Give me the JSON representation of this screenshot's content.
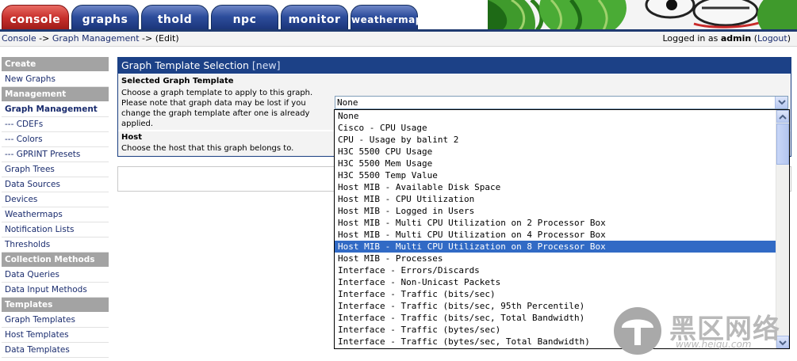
{
  "tabs": [
    {
      "label": "console",
      "active": true
    },
    {
      "label": "graphs",
      "active": false
    },
    {
      "label": "thold",
      "active": false
    },
    {
      "label": "npc",
      "active": false
    },
    {
      "label": "monitor",
      "active": false
    },
    {
      "label": "weathermap",
      "active": false
    }
  ],
  "breadcrumb": {
    "console": "Console",
    "sep1": " -> ",
    "management": "Graph Management",
    "sep2": " -> ",
    "current": "(Edit)"
  },
  "login": {
    "prefix": "Logged in as ",
    "user": "admin",
    "open": " (",
    "logout": "Logout",
    "close": ")"
  },
  "sidebar": {
    "sections": [
      {
        "header": "Create",
        "items": [
          {
            "label": "New Graphs"
          }
        ]
      },
      {
        "header": "Management",
        "items": [
          {
            "label": "Graph Management",
            "selected": true
          },
          {
            "label": "--- CDEFs"
          },
          {
            "label": "--- Colors"
          },
          {
            "label": "--- GPRINT Presets"
          },
          {
            "label": "Graph Trees"
          },
          {
            "label": "Data Sources"
          },
          {
            "label": "Devices"
          },
          {
            "label": "Weathermaps"
          },
          {
            "label": "Notification Lists"
          },
          {
            "label": "Thresholds"
          }
        ]
      },
      {
        "header": "Collection Methods",
        "items": [
          {
            "label": "Data Queries"
          },
          {
            "label": "Data Input Methods"
          }
        ]
      },
      {
        "header": "Templates",
        "items": [
          {
            "label": "Graph Templates"
          },
          {
            "label": "Host Templates"
          },
          {
            "label": "Data Templates"
          }
        ]
      }
    ]
  },
  "panel": {
    "title": "Graph Template Selection",
    "title_tag": "[new]",
    "field1_label": "Selected Graph Template",
    "field1_desc": "Choose a graph template to apply to this graph. Please note that graph data may be lost if you change the graph template after one is already applied.",
    "field2_label": "Host",
    "field2_desc": "Choose the host that this graph belongs to."
  },
  "select": {
    "value": "None",
    "highlighted_index": 11,
    "options": [
      "None",
      "Cisco - CPU Usage",
      "CPU - Usage by balint 2",
      "H3C 5500 CPU Usage",
      "H3C 5500 Mem Usage",
      "H3C 5500 Temp Value",
      "Host MIB - Available Disk Space",
      "Host MIB - CPU Utilization",
      "Host MIB - Logged in Users",
      "Host MIB - Multi CPU Utilization on 2 Processor Box",
      "Host MIB - Multi CPU Utilization on 4 Processor Box",
      "Host MIB - Multi CPU Utilization on 8 Processor Box",
      "Host MIB - Processes",
      "Interface - Errors/Discards",
      "Interface - Non-Unicast Packets",
      "Interface - Traffic (bits/sec)",
      "Interface - Traffic (bits/sec, 95th Percentile)",
      "Interface - Traffic (bits/sec, Total Bandwidth)",
      "Interface - Traffic (bytes/sec)",
      "Interface - Traffic (bytes/sec, Total Bandwidth)"
    ]
  },
  "watermark": {
    "brand": "黑区网络",
    "url": "www.heiqu.com"
  },
  "colors": {
    "tab_active": "#c8302c",
    "tab": "#2d4d9c",
    "panel_header": "#1c4187",
    "menu_header": "#a3a3a3",
    "highlight": "#316ac5"
  }
}
